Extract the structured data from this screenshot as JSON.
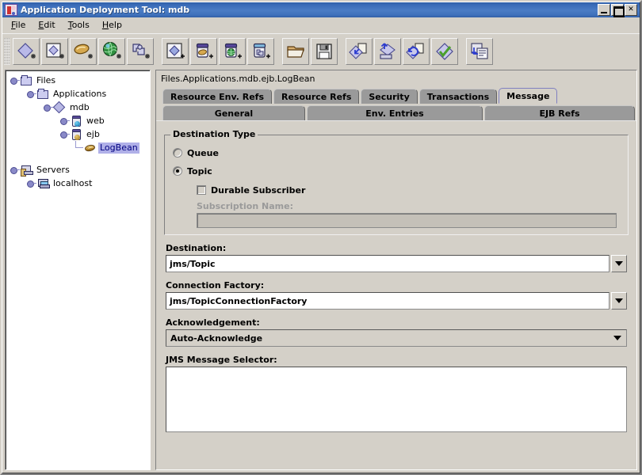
{
  "window": {
    "title": "Application Deployment Tool: mdb",
    "icon": "app-duke-icon",
    "buttons": {
      "minimize": "_",
      "maximize": "□",
      "close": "✕"
    }
  },
  "menubar": {
    "items": [
      {
        "label": "File",
        "mnemonic": "F"
      },
      {
        "label": "Edit",
        "mnemonic": "E"
      },
      {
        "label": "Tools",
        "mnemonic": "T"
      },
      {
        "label": "Help",
        "mnemonic": "H"
      }
    ]
  },
  "toolbar": {
    "groups": [
      {
        "name": "new-module-group",
        "buttons": [
          {
            "icon": "new-application-icon",
            "tooltip": "New Application"
          },
          {
            "icon": "new-ejb-module-icon",
            "tooltip": "New EJB Module"
          },
          {
            "icon": "new-enterprise-bean-icon",
            "tooltip": "New Enterprise Bean"
          },
          {
            "icon": "new-web-component-icon",
            "tooltip": "New Web Component"
          },
          {
            "icon": "new-app-client-icon",
            "tooltip": "New Application Client"
          }
        ]
      },
      {
        "name": "add-to-app-group",
        "buttons": [
          {
            "icon": "add-module-icon",
            "tooltip": "Add Module"
          },
          {
            "icon": "add-ejb-jar-icon",
            "tooltip": "Add EJB JAR"
          },
          {
            "icon": "add-web-war-icon",
            "tooltip": "Add Web WAR"
          },
          {
            "icon": "add-client-jar-icon",
            "tooltip": "Add Client JAR"
          }
        ]
      },
      {
        "name": "file-group",
        "buttons": [
          {
            "icon": "open-folder-icon",
            "tooltip": "Open"
          },
          {
            "icon": "save-floppy-icon",
            "tooltip": "Save"
          }
        ]
      },
      {
        "name": "deploy-group",
        "buttons": [
          {
            "icon": "deploy-icon",
            "tooltip": "Deploy"
          },
          {
            "icon": "undeploy-icon",
            "tooltip": "Undeploy"
          },
          {
            "icon": "redeploy-icon",
            "tooltip": "Redeploy"
          },
          {
            "icon": "verify-check-icon",
            "tooltip": "Verify"
          }
        ]
      },
      {
        "name": "tools-group",
        "buttons": [
          {
            "icon": "generate-sql-icon",
            "tooltip": "Generate SQL"
          }
        ]
      }
    ]
  },
  "tree": {
    "nodes": [
      {
        "label": "Files",
        "icon": "folder-icon",
        "depth": 0,
        "expanded": true,
        "selected": false
      },
      {
        "label": "Applications",
        "icon": "folder-icon",
        "depth": 1,
        "expanded": true,
        "selected": false
      },
      {
        "label": "mdb",
        "icon": "diamond-icon",
        "depth": 2,
        "expanded": true,
        "selected": false
      },
      {
        "label": "web",
        "icon": "web-jar-icon",
        "depth": 3,
        "expanded": false,
        "selected": false
      },
      {
        "label": "ejb",
        "icon": "ejb-jar-icon",
        "depth": 3,
        "expanded": true,
        "selected": false
      },
      {
        "label": "LogBean",
        "icon": "bean-icon",
        "depth": 4,
        "expanded": null,
        "selected": true
      },
      {
        "label": "Servers",
        "icon": "servers-icon",
        "depth": 0,
        "expanded": true,
        "selected": false
      },
      {
        "label": "localhost",
        "icon": "host-icon",
        "depth": 1,
        "expanded": false,
        "selected": false
      }
    ]
  },
  "inspector": {
    "path": "Files.Applications.mdb.ejb.LogBean",
    "tab_rows": [
      {
        "name": "tab-row-top",
        "tabs": [
          {
            "label": "Resource Env. Refs",
            "selected": false
          },
          {
            "label": "Resource Refs",
            "selected": false
          },
          {
            "label": "Security",
            "selected": false
          },
          {
            "label": "Transactions",
            "selected": false
          },
          {
            "label": "Message",
            "selected": true
          }
        ]
      },
      {
        "name": "tab-row-bottom",
        "tabs": [
          {
            "label": "General",
            "selected": false
          },
          {
            "label": "Env. Entries",
            "selected": false
          },
          {
            "label": "EJB Refs",
            "selected": false
          }
        ]
      }
    ]
  },
  "message_tab": {
    "destination_type": {
      "legend": "Destination Type",
      "options": [
        {
          "label": "Queue",
          "selected": false
        },
        {
          "label": "Topic",
          "selected": true
        }
      ],
      "durable_subscriber": {
        "label": "Durable Subscriber",
        "checked": false
      },
      "subscription_name": {
        "label": "Subscription Name:",
        "value": "",
        "enabled": false
      }
    },
    "destination": {
      "label": "Destination:",
      "value": "jms/Topic",
      "editable": true
    },
    "connection_factory": {
      "label": "Connection Factory:",
      "value": "jms/TopicConnectionFactory",
      "editable": true
    },
    "acknowledgement": {
      "label": "Acknowledgement:",
      "value": "Auto-Acknowledge"
    },
    "jms_message_selector": {
      "label": "JMS Message Selector:",
      "value": ""
    }
  },
  "colors": {
    "titlebar_blue": "#3a6cb8",
    "face": "#d4d0c8",
    "tab_unselected": "#9a9a9a",
    "selection": "#b0b0e8",
    "selection_text": "#000080",
    "disabled_text": "#9a9a9a"
  }
}
